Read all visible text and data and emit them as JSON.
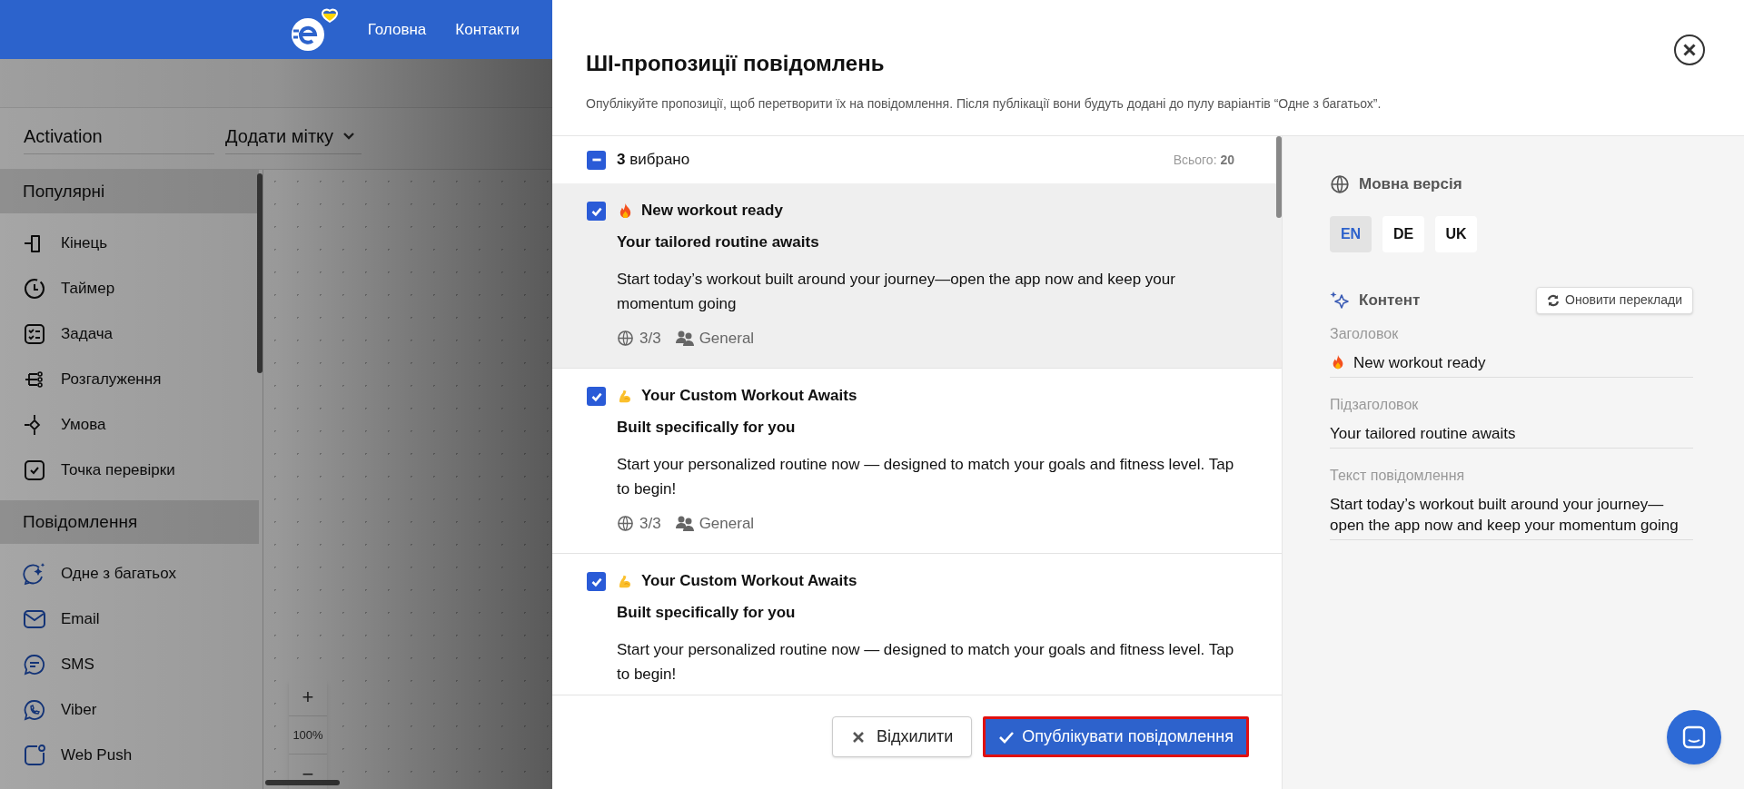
{
  "header": {
    "nav": [
      "Головна",
      "Контакти"
    ]
  },
  "toolbar": {
    "name_field": "Activation",
    "tag_select": "Додати мітку"
  },
  "sidebar": {
    "sections": [
      {
        "title": "Популярні",
        "items": [
          {
            "label": "Кінець",
            "kind": "end"
          },
          {
            "label": "Таймер",
            "kind": "timer"
          },
          {
            "label": "Задача",
            "kind": "task"
          },
          {
            "label": "Розгалуження",
            "kind": "branch"
          },
          {
            "label": "Умова",
            "kind": "condition"
          },
          {
            "label": "Точка перевірки",
            "kind": "checkpoint"
          }
        ]
      },
      {
        "title": "Повідомлення",
        "items": [
          {
            "label": "Одне з багатьох",
            "kind": "variants"
          },
          {
            "label": "Email",
            "kind": "email"
          },
          {
            "label": "SMS",
            "kind": "sms"
          },
          {
            "label": "Viber",
            "kind": "viber"
          },
          {
            "label": "Web Push",
            "kind": "webpush"
          }
        ]
      }
    ]
  },
  "zoom": {
    "plus": "+",
    "level": "100%",
    "minus": "−"
  },
  "modal": {
    "title": "ШІ-пропозиції повідомлень",
    "subtitle": "Опублікуйте пропозиції, щоб перетворити їх на повідомлення. Після публікації вони будуть додані до пулу варіантів “Одне з багатьох”.",
    "select_all": {
      "indeterminate": true,
      "label": "**3** вибрано"
    },
    "total": "Всього: **20**",
    "suggestions": [
      {
        "kind": "flame",
        "selected": true,
        "checked": true,
        "title": "New workout ready",
        "subtitle": "Your tailored routine awaits",
        "body": "Start today’s workout built around your journey—open the app now and keep your momentum going",
        "languages": "3/3",
        "segment": "General"
      },
      {
        "kind": "arm",
        "selected": false,
        "checked": true,
        "title": "Your Custom Workout Awaits",
        "subtitle": "Built specifically for you",
        "body": "Start your personalized routine now — designed to match your goals and fitness level. Tap to begin!",
        "languages": "3/3",
        "segment": "General"
      },
      {
        "kind": "arm",
        "selected": false,
        "checked": true,
        "title": "Your Custom Workout Awaits",
        "subtitle": "Built specifically for you",
        "body": "Start your personalized routine now — designed to match your goals and fitness level. Tap to begin!"
      }
    ],
    "preview": {
      "language_heading": "Мовна версія",
      "languages": [
        {
          "label": "EN",
          "selected": true
        },
        {
          "label": "DE",
          "selected": false
        },
        {
          "label": "UK",
          "selected": false
        }
      ],
      "content_heading": "Контент",
      "refresh_button": "Оновити переклади",
      "fields": [
        {
          "label": "Заголовок",
          "value": "New workout ready",
          "kind": "flame"
        },
        {
          "label": "Підзаголовок",
          "value": "Your tailored routine awaits",
          "kind": "plain"
        },
        {
          "label": "Текст повідомлення",
          "value": "Start today’s workout built around your journey—open the app now and keep your momentum going",
          "kind": "plain"
        }
      ]
    },
    "buttons": {
      "reject": "Відхилити",
      "publish": "Опублікувати повідомлення"
    }
  }
}
